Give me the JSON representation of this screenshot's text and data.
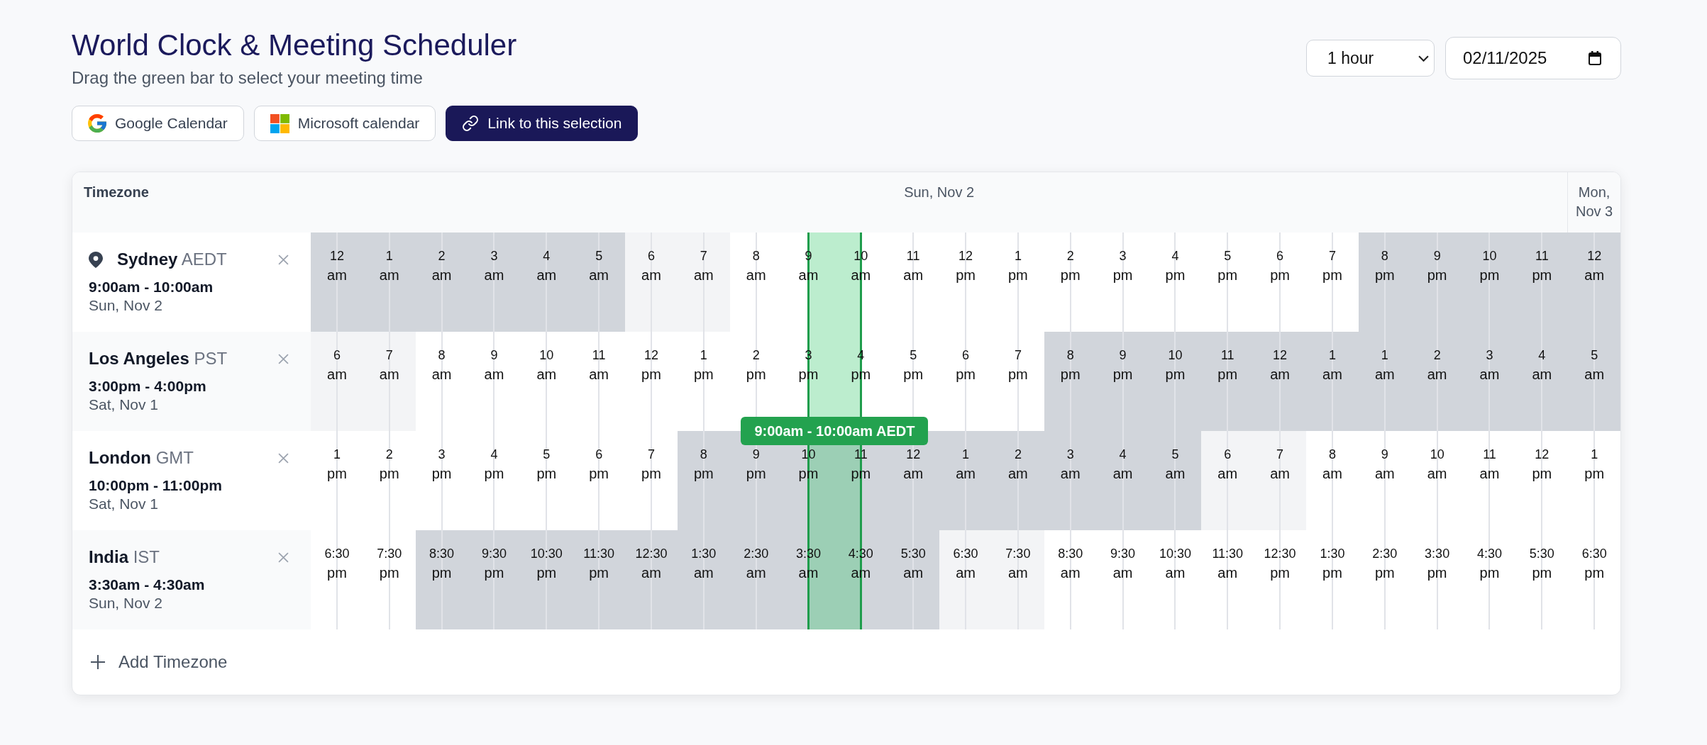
{
  "header": {
    "title": "World Clock & Meeting Scheduler",
    "subtitle": "Drag the green bar to select your meeting time"
  },
  "actions": [
    {
      "kind": "google",
      "label": "Google Calendar"
    },
    {
      "kind": "microsoft",
      "label": "Microsoft calendar"
    },
    {
      "kind": "link",
      "label": "Link to this selection"
    }
  ],
  "controls": {
    "duration": {
      "value": "1 hour"
    },
    "date": {
      "value": "02/11/2025"
    }
  },
  "table": {
    "timezone_heading": "Timezone",
    "days": [
      {
        "label": "Sun, Nov 2",
        "columns": [
          {
            "selected": false
          },
          {
            "selected": false
          },
          {
            "selected": false
          },
          {
            "selected": false
          },
          {
            "selected": false
          },
          {
            "selected": false
          },
          {
            "selected": false
          },
          {
            "selected": false
          },
          {
            "selected": false
          },
          {
            "selected": true
          },
          {
            "selected": false
          },
          {
            "selected": false
          },
          {
            "selected": false
          },
          {
            "selected": false
          },
          {
            "selected": false
          },
          {
            "selected": false
          },
          {
            "selected": false
          },
          {
            "selected": false
          },
          {
            "selected": false
          },
          {
            "selected": false
          },
          {
            "selected": false
          },
          {
            "selected": false
          },
          {
            "selected": false
          },
          {
            "selected": false
          }
        ]
      },
      {
        "label": "Mon, Nov 3",
        "columns": [
          {
            "selected": false
          }
        ]
      }
    ],
    "selection": {
      "label": "9:00am - 10:00am AEDT"
    },
    "timezones": [
      {
        "home": true,
        "city": "Sydney",
        "abbr": "AEDT",
        "range": "9:00am - 10:00am",
        "date": "Sun, Nov 2",
        "cells": [
          {
            "hour": "12",
            "period": "am",
            "kind": "night"
          },
          {
            "hour": "1",
            "period": "am",
            "kind": "night"
          },
          {
            "hour": "2",
            "period": "am",
            "kind": "night"
          },
          {
            "hour": "3",
            "period": "am",
            "kind": "night"
          },
          {
            "hour": "4",
            "period": "am",
            "kind": "night"
          },
          {
            "hour": "5",
            "period": "am",
            "kind": "night"
          },
          {
            "hour": "6",
            "period": "am",
            "kind": "twilight"
          },
          {
            "hour": "7",
            "period": "am",
            "kind": "twilight"
          },
          {
            "hour": "8",
            "period": "am",
            "kind": "day"
          },
          {
            "hour": "9",
            "period": "am",
            "kind": "day"
          },
          {
            "hour": "10",
            "period": "am",
            "kind": "day"
          },
          {
            "hour": "11",
            "period": "am",
            "kind": "day"
          },
          {
            "hour": "12",
            "period": "pm",
            "kind": "day"
          },
          {
            "hour": "1",
            "period": "pm",
            "kind": "day"
          },
          {
            "hour": "2",
            "period": "pm",
            "kind": "day"
          },
          {
            "hour": "3",
            "period": "pm",
            "kind": "day"
          },
          {
            "hour": "4",
            "period": "pm",
            "kind": "day"
          },
          {
            "hour": "5",
            "period": "pm",
            "kind": "day"
          },
          {
            "hour": "6",
            "period": "pm",
            "kind": "day"
          },
          {
            "hour": "7",
            "period": "pm",
            "kind": "day"
          },
          {
            "hour": "8",
            "period": "pm",
            "kind": "night"
          },
          {
            "hour": "9",
            "period": "pm",
            "kind": "night"
          },
          {
            "hour": "10",
            "period": "pm",
            "kind": "night"
          },
          {
            "hour": "11",
            "period": "pm",
            "kind": "night"
          },
          {
            "hour": "12",
            "period": "am",
            "kind": "night"
          }
        ]
      },
      {
        "home": false,
        "city": "Los Angeles",
        "abbr": "PST",
        "range": "3:00pm - 4:00pm",
        "date": "Sat, Nov 1",
        "cells": [
          {
            "hour": "6",
            "period": "am",
            "kind": "twilight"
          },
          {
            "hour": "7",
            "period": "am",
            "kind": "twilight"
          },
          {
            "hour": "8",
            "period": "am",
            "kind": "day"
          },
          {
            "hour": "9",
            "period": "am",
            "kind": "day"
          },
          {
            "hour": "10",
            "period": "am",
            "kind": "day"
          },
          {
            "hour": "11",
            "period": "am",
            "kind": "day"
          },
          {
            "hour": "12",
            "period": "pm",
            "kind": "day"
          },
          {
            "hour": "1",
            "period": "pm",
            "kind": "day"
          },
          {
            "hour": "2",
            "period": "pm",
            "kind": "day"
          },
          {
            "hour": "3",
            "period": "pm",
            "kind": "day"
          },
          {
            "hour": "4",
            "period": "pm",
            "kind": "day"
          },
          {
            "hour": "5",
            "period": "pm",
            "kind": "day"
          },
          {
            "hour": "6",
            "period": "pm",
            "kind": "day"
          },
          {
            "hour": "7",
            "period": "pm",
            "kind": "day"
          },
          {
            "hour": "8",
            "period": "pm",
            "kind": "night"
          },
          {
            "hour": "9",
            "period": "pm",
            "kind": "night"
          },
          {
            "hour": "10",
            "period": "pm",
            "kind": "night"
          },
          {
            "hour": "11",
            "period": "pm",
            "kind": "night"
          },
          {
            "hour": "12",
            "period": "am",
            "kind": "night"
          },
          {
            "hour": "1",
            "period": "am",
            "kind": "night"
          },
          {
            "hour": "1",
            "period": "am",
            "kind": "night"
          },
          {
            "hour": "2",
            "period": "am",
            "kind": "night"
          },
          {
            "hour": "3",
            "period": "am",
            "kind": "night"
          },
          {
            "hour": "4",
            "period": "am",
            "kind": "night"
          },
          {
            "hour": "5",
            "period": "am",
            "kind": "night"
          }
        ]
      },
      {
        "home": false,
        "city": "London",
        "abbr": "GMT",
        "range": "10:00pm - 11:00pm",
        "date": "Sat, Nov 1",
        "cells": [
          {
            "hour": "1",
            "period": "pm",
            "kind": "day"
          },
          {
            "hour": "2",
            "period": "pm",
            "kind": "day"
          },
          {
            "hour": "3",
            "period": "pm",
            "kind": "day"
          },
          {
            "hour": "4",
            "period": "pm",
            "kind": "day"
          },
          {
            "hour": "5",
            "period": "pm",
            "kind": "day"
          },
          {
            "hour": "6",
            "period": "pm",
            "kind": "day"
          },
          {
            "hour": "7",
            "period": "pm",
            "kind": "day"
          },
          {
            "hour": "8",
            "period": "pm",
            "kind": "night"
          },
          {
            "hour": "9",
            "period": "pm",
            "kind": "night"
          },
          {
            "hour": "10",
            "period": "pm",
            "kind": "night"
          },
          {
            "hour": "11",
            "period": "pm",
            "kind": "night"
          },
          {
            "hour": "12",
            "period": "am",
            "kind": "night"
          },
          {
            "hour": "1",
            "period": "am",
            "kind": "night"
          },
          {
            "hour": "2",
            "period": "am",
            "kind": "night"
          },
          {
            "hour": "3",
            "period": "am",
            "kind": "night"
          },
          {
            "hour": "4",
            "period": "am",
            "kind": "night"
          },
          {
            "hour": "5",
            "period": "am",
            "kind": "night"
          },
          {
            "hour": "6",
            "period": "am",
            "kind": "twilight"
          },
          {
            "hour": "7",
            "period": "am",
            "kind": "twilight"
          },
          {
            "hour": "8",
            "period": "am",
            "kind": "day"
          },
          {
            "hour": "9",
            "period": "am",
            "kind": "day"
          },
          {
            "hour": "10",
            "period": "am",
            "kind": "day"
          },
          {
            "hour": "11",
            "period": "am",
            "kind": "day"
          },
          {
            "hour": "12",
            "period": "pm",
            "kind": "day"
          },
          {
            "hour": "1",
            "period": "pm",
            "kind": "day"
          }
        ]
      },
      {
        "home": false,
        "city": "India",
        "abbr": "IST",
        "range": "3:30am - 4:30am",
        "date": "Sun, Nov 2",
        "cells": [
          {
            "hour": "6:30",
            "period": "pm",
            "kind": "day"
          },
          {
            "hour": "7:30",
            "period": "pm",
            "kind": "day"
          },
          {
            "hour": "8:30",
            "period": "pm",
            "kind": "night"
          },
          {
            "hour": "9:30",
            "period": "pm",
            "kind": "night"
          },
          {
            "hour": "10:30",
            "period": "pm",
            "kind": "night"
          },
          {
            "hour": "11:30",
            "period": "pm",
            "kind": "night"
          },
          {
            "hour": "12:30",
            "period": "am",
            "kind": "night"
          },
          {
            "hour": "1:30",
            "period": "am",
            "kind": "night"
          },
          {
            "hour": "2:30",
            "period": "am",
            "kind": "night"
          },
          {
            "hour": "3:30",
            "period": "am",
            "kind": "night"
          },
          {
            "hour": "4:30",
            "period": "am",
            "kind": "night"
          },
          {
            "hour": "5:30",
            "period": "am",
            "kind": "night"
          },
          {
            "hour": "6:30",
            "period": "am",
            "kind": "twilight"
          },
          {
            "hour": "7:30",
            "period": "am",
            "kind": "twilight"
          },
          {
            "hour": "8:30",
            "period": "am",
            "kind": "day"
          },
          {
            "hour": "9:30",
            "period": "am",
            "kind": "day"
          },
          {
            "hour": "10:30",
            "period": "am",
            "kind": "day"
          },
          {
            "hour": "11:30",
            "period": "am",
            "kind": "day"
          },
          {
            "hour": "12:30",
            "period": "pm",
            "kind": "day"
          },
          {
            "hour": "1:30",
            "period": "pm",
            "kind": "day"
          },
          {
            "hour": "2:30",
            "period": "pm",
            "kind": "day"
          },
          {
            "hour": "3:30",
            "period": "pm",
            "kind": "day"
          },
          {
            "hour": "4:30",
            "period": "pm",
            "kind": "day"
          },
          {
            "hour": "5:30",
            "period": "pm",
            "kind": "day"
          },
          {
            "hour": "6:30",
            "period": "pm",
            "kind": "day"
          }
        ]
      }
    ],
    "add_button": {
      "label": "Add Timezone"
    }
  }
}
